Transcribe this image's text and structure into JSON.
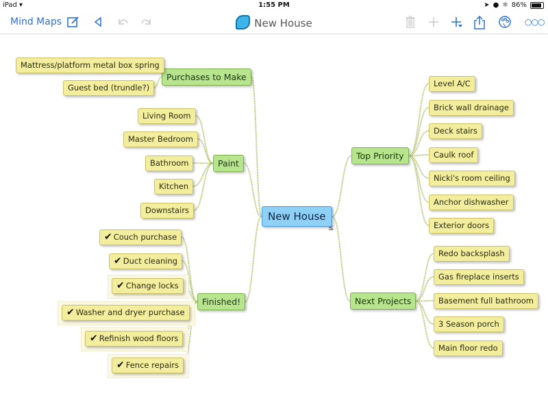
{
  "status_bar": {
    "device": "iPad",
    "wifi_icon": "wifi-icon",
    "time": "1:55 PM",
    "battery_percent": "86%",
    "battery_level": 0.86,
    "icons": [
      "location-icon",
      "alarm-icon",
      "bluetooth-icon",
      "battery-icon"
    ]
  },
  "toolbar": {
    "back_label": "Mind Maps",
    "doc_title": "New House",
    "left_icons": [
      "compose-icon",
      "collapse-sidebar-icon",
      "undo-icon",
      "redo-icon"
    ],
    "right_icons": [
      "trash-icon",
      "add-icon",
      "add-child-icon",
      "share-icon",
      "theme-palette-icon",
      "more-icon"
    ]
  },
  "mindmap": {
    "root": "New House",
    "branches": [
      {
        "label": "Purchases to Make",
        "side": "left",
        "children": [
          "Mattress/platform metal box spring",
          "Guest bed (trundle?)"
        ]
      },
      {
        "label": "Paint",
        "side": "left",
        "children": [
          "Living Room",
          "Master Bedroom",
          "Bathroom",
          "Kitchen",
          "Downstairs"
        ]
      },
      {
        "label": "Finished!",
        "side": "left",
        "children": [
          "Couch purchase",
          "Duct cleaning",
          "Change locks",
          "Washer and dryer purchase",
          "Refinish wood floors",
          "Fence repairs"
        ],
        "completed": true
      },
      {
        "label": "Top Priority",
        "side": "right",
        "children": [
          "Level A/C",
          "Brick wall drainage",
          "Deck stairs",
          "Caulk roof",
          "Nicki's room ceiling",
          "Anchor dishwasher",
          "Exterior doors"
        ]
      },
      {
        "label": "Next Projects",
        "side": "right",
        "children": [
          "Redo backsplash",
          "Gas fireplace inserts",
          "Basement full bathroom",
          "3 Season porch",
          "Main floor redo"
        ]
      }
    ],
    "check_glyph": "✔",
    "colors": {
      "root": "#8fd0f7",
      "branch": "#b7e58d",
      "leaf": "#f3ee9e",
      "link": "#a3b95a"
    }
  }
}
